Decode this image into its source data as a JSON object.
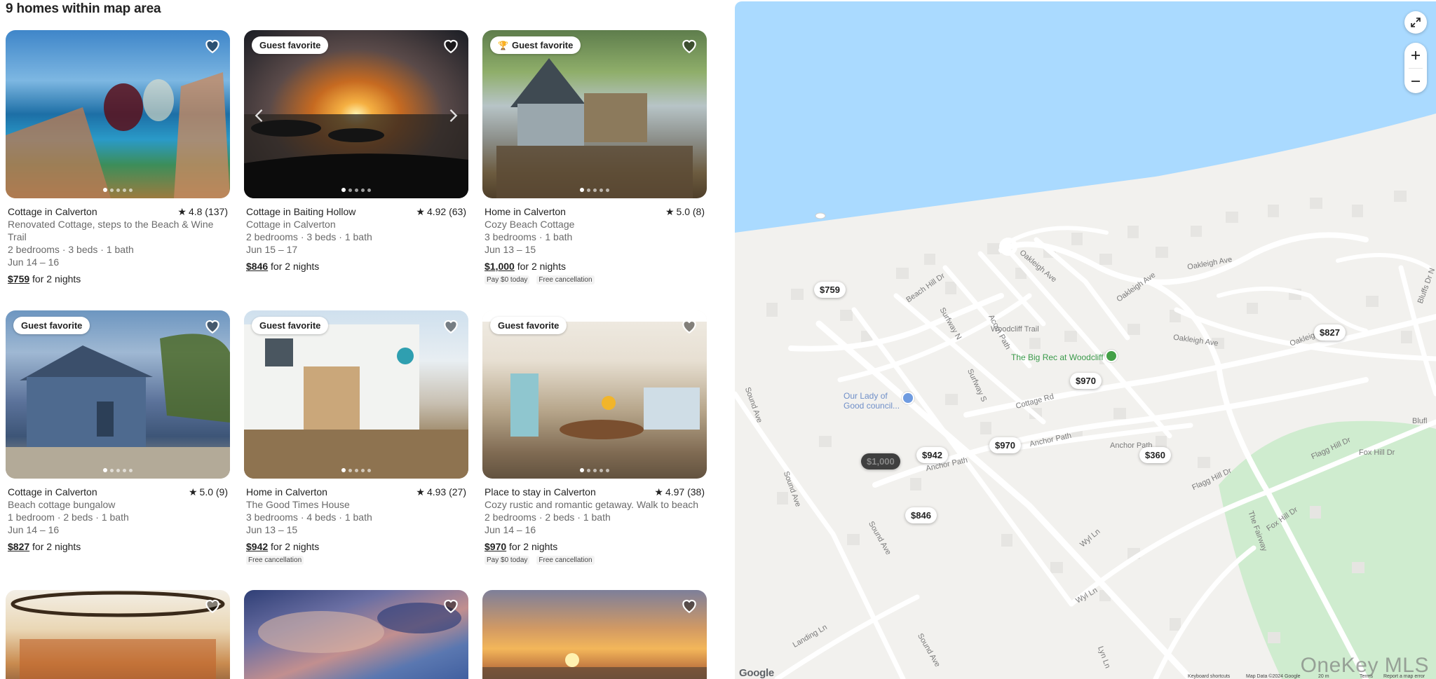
{
  "results": {
    "title": "9 homes within map area"
  },
  "listings": [
    {
      "title": "Cottage in Calverton",
      "rating": "4.8 (137)",
      "subtitle": "Renovated Cottage, steps to the Beach & Wine Trail",
      "beds": "2 bedrooms · 3 beds · 1 bath",
      "dates": "Jun 14 – 16",
      "price": "$759",
      "price_suffix": " for 2 nights"
    },
    {
      "badge": "Guest favorite",
      "title": "Cottage in Baiting Hollow",
      "rating": "4.92 (63)",
      "subtitle": "Cottage in Calverton",
      "beds": "2 bedrooms · 3 beds · 1 bath",
      "dates": "Jun 15 – 17",
      "price": "$846",
      "price_suffix": " for 2 nights"
    },
    {
      "badge": "Guest favorite",
      "title": "Home in Calverton",
      "rating": "5.0 (8)",
      "subtitle": "Cozy Beach Cottage",
      "beds": "3 bedrooms · 1 bath",
      "dates": "Jun 13 – 15",
      "price": "$1,000",
      "price_suffix": " for 2 nights",
      "tag1": "Pay $0 today",
      "tag2": "Free cancellation"
    },
    {
      "badge": "Guest favorite",
      "title": "Cottage in Calverton",
      "rating": "5.0 (9)",
      "subtitle": "Beach cottage bungalow",
      "beds": "1 bedroom · 2 beds · 1 bath",
      "dates": "Jun 14 – 16",
      "price": "$827",
      "price_suffix": " for 2 nights"
    },
    {
      "badge": "Guest favorite",
      "title": "Home in Calverton",
      "rating": "4.93 (27)",
      "subtitle": "The Good Times House",
      "beds": "3 bedrooms · 4 beds · 1 bath",
      "dates": "Jun 13 – 15",
      "price": "$942",
      "price_suffix": " for 2 nights",
      "tag1": "Free cancellation"
    },
    {
      "badge": "Guest favorite",
      "title": "Place to stay in Calverton",
      "rating": "4.97 (38)",
      "subtitle": "Cozy rustic and romantic getaway. Walk to beach",
      "beds": "2 bedrooms · 2 beds · 1 bath",
      "dates": "Jun 14 – 16",
      "price": "$970",
      "price_suffix": " for 2 nights",
      "tag1": "Pay $0 today",
      "tag2": "Free cancellation"
    }
  ],
  "map": {
    "pins": [
      "$759",
      "$827",
      "$970",
      "$942",
      "$970",
      "$360",
      "$1,000",
      "$846"
    ],
    "streets": [
      "Oakleigh Ave",
      "Oakleigh Ave",
      "Oakleigh Ave",
      "Oakleigh Ave",
      "Oakleigh Ave",
      "Beach Hill Dr",
      "Surfway N",
      "Acorn Path",
      "Woodcliff Trail",
      "Cottage Rd",
      "Surfway S",
      "Anchor Path",
      "Anchor Path",
      "Anchor Path",
      "Flagg Hill Dr",
      "Flagg Hill Dr",
      "Fox Hill Dr",
      "Fox Hill Dr",
      "Sound Ave",
      "Sound Ave",
      "Sound Ave",
      "Sound Ave",
      "Wyl Ln",
      "Wyl Ln",
      "The Fairway",
      "Landing Ln",
      "Lyn Ln",
      "Bluffs Dr N",
      "Blufl"
    ],
    "poi_rec": "The Big Rec at Woodcliff",
    "poi_church_1": "Our Lady of",
    "poi_church_2": "Good council...",
    "google": "Google",
    "footer": [
      "Keyboard shortcuts",
      "Map Data ©2024 Google",
      "20 m",
      "Terms",
      "Report a map error"
    ],
    "watermark": "OneKey MLS",
    "colors": {
      "water": "#aadaff",
      "land": "#f2f1ee",
      "park": "#cfeccf",
      "road": "#ffffff",
      "pin_selected": "#3f3f3f"
    }
  }
}
